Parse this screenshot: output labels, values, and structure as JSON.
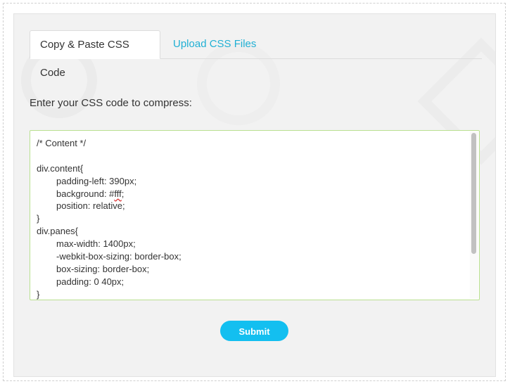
{
  "tabs": [
    {
      "label": "Copy & Paste CSS Code",
      "active": true
    },
    {
      "label": "Upload CSS Files",
      "active": false
    }
  ],
  "prompt": "Enter your CSS code to compress:",
  "code": {
    "lines": [
      {
        "indent": 0,
        "text": "/* Content */"
      },
      {
        "indent": 0,
        "text": ""
      },
      {
        "indent": 0,
        "text": "div.content{"
      },
      {
        "indent": 1,
        "text": "padding-left: 390px;"
      },
      {
        "indent": 1,
        "text": "background: #fff;"
      },
      {
        "indent": 1,
        "text": "position: relative;"
      },
      {
        "indent": 0,
        "text": "}"
      },
      {
        "indent": 0,
        "text": "div.panes{"
      },
      {
        "indent": 1,
        "text": "max-width: 1400px;"
      },
      {
        "indent": 1,
        "text": "-webkit-box-sizing: border-box;"
      },
      {
        "indent": 1,
        "text": "box-sizing: border-box;"
      },
      {
        "indent": 1,
        "text": "padding: 0 40px;"
      },
      {
        "indent": 0,
        "text": "}"
      }
    ]
  },
  "submit_label": "Submit",
  "colors": {
    "accent": "#13bff0",
    "tab_link": "#21b0d4",
    "textarea_border": "#b9e08f",
    "panel_bg": "#f2f2f2"
  }
}
